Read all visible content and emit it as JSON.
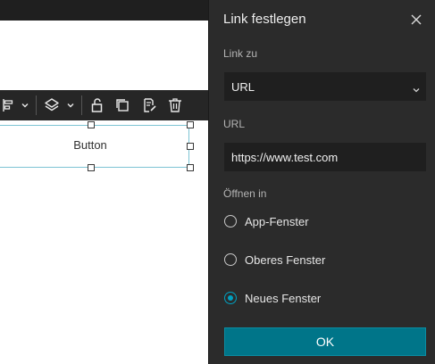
{
  "canvas": {
    "button_widget_label": "Button"
  },
  "toolbar": {
    "icons": [
      "align-icon",
      "chevron-down-icon",
      "layers-icon",
      "chevron-down-icon",
      "unlock-icon",
      "duplicate-icon",
      "edit-page-icon",
      "delete-icon"
    ]
  },
  "dialog": {
    "title": "Link festlegen",
    "link_to_label": "Link zu",
    "link_to_value": "URL",
    "url_label": "URL",
    "url_value": "https://www.test.com",
    "open_in_label": "Öffnen in",
    "open_in_options": [
      {
        "label": "App-Fenster",
        "checked": false
      },
      {
        "label": "Oberes Fenster",
        "checked": false
      },
      {
        "label": "Neues Fenster",
        "checked": true
      }
    ],
    "ok_label": "OK"
  },
  "colors": {
    "panel_bg": "#2b2b2b",
    "field_bg": "#1f1f1f",
    "accent": "#00a0c0",
    "ok_button": "#007589",
    "selection_border": "#7ec4d4"
  }
}
